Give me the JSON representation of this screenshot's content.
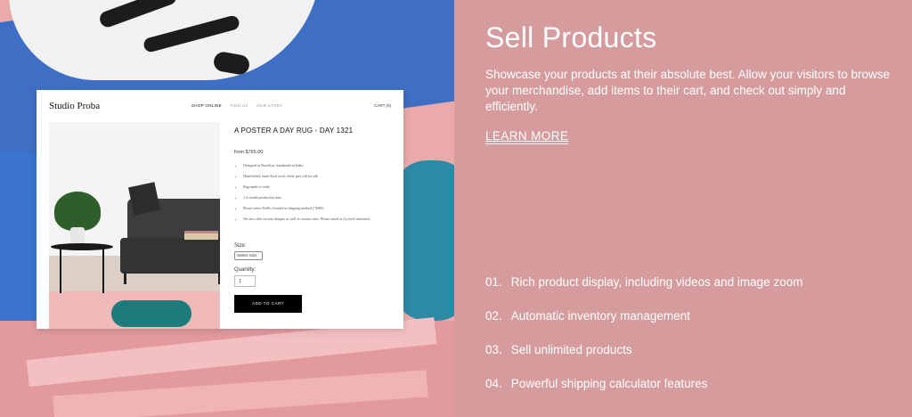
{
  "mockup": {
    "brand": "Studio Proba",
    "nav": [
      "SHOP ONLINE",
      "FIND US",
      "OUR STORY"
    ],
    "cart": "CART (0)",
    "product_title": "A POSTER A DAY RUG - DAY 1321",
    "price": "from $765.00",
    "bullets": [
      "Designed in Brooklyn, handmade in India",
      "Hand-tufted, hand dyed wool, silver part will be silk",
      "Rug made to order",
      "1-2 month production time",
      "Please select FedEx Ground as shipping method (\"$380)",
      "We also offer custom designs as well as custom sizes. Please email us if you're interested."
    ],
    "size_label": "Size:",
    "size_select": "Select Size",
    "quantity_label": "Quantity:",
    "quantity_value": "1",
    "add_to_cart": "ADD TO CART"
  },
  "panel": {
    "title": "Sell Products",
    "description": "Showcase your products at their absolute best. Allow your visitors to browse your merchandise, add items to their cart, and check out simply and efficiently.",
    "learn_more": "LEARN MORE",
    "features": [
      {
        "num": "01.",
        "text": "Rich product display, including videos and image zoom"
      },
      {
        "num": "02.",
        "text": "Automatic inventory management"
      },
      {
        "num": "03.",
        "text": "Sell unlimited products"
      },
      {
        "num": "04.",
        "text": "Powerful shipping calculator features"
      }
    ]
  },
  "colors": {
    "panel_bg": "#d69c9d",
    "text": "#ffffff",
    "button_bg": "#000000"
  }
}
